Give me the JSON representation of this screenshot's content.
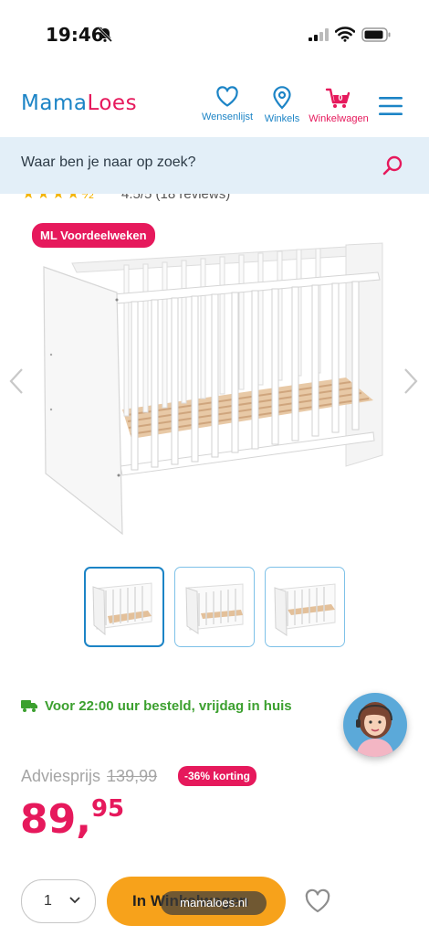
{
  "status_bar": {
    "time": "19:46"
  },
  "header": {
    "logo_part1": "Mama",
    "logo_part2": "Loes",
    "nav": [
      {
        "label": "Wensenlijst",
        "icon": "heart-icon"
      },
      {
        "label": "Winkels",
        "icon": "location-pin-icon"
      },
      {
        "label": "Winkelwagen",
        "icon": "cart-icon",
        "count": "0"
      }
    ]
  },
  "search": {
    "placeholder": "Waar ben je naar op zoek?"
  },
  "rating": {
    "stars": "★★★★½",
    "text": "4.5/5 (18 reviews)"
  },
  "gallery": {
    "badge": "ML Voordeelweken",
    "thumbnail_count": 3
  },
  "delivery": {
    "text": "Voor 22:00 uur besteld, vrijdag in huis"
  },
  "pricing": {
    "advice_label": "Adviesprijs",
    "advice_price": "139,99",
    "discount": "-36% korting",
    "price_int": "89,",
    "price_dec": "95"
  },
  "purchase": {
    "quantity": "1",
    "add_button_label": "In Winkelwagen",
    "url_overlay": "mamaloes.nl"
  },
  "colors": {
    "brand_blue": "#1c84c6",
    "brand_pink": "#e6195c",
    "cta_orange": "#f7a21b",
    "delivery_green": "#3ca02f"
  }
}
